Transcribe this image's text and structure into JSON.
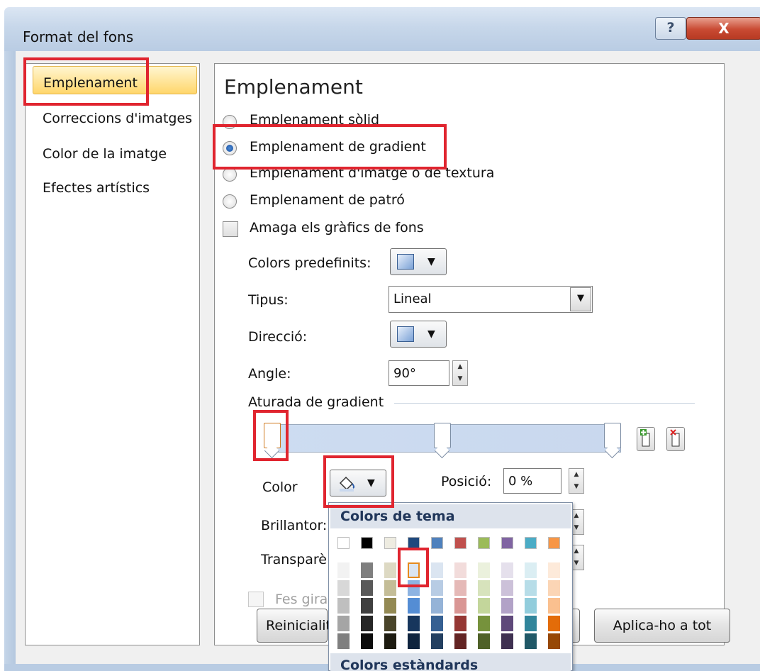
{
  "window": {
    "title": "Format del fons",
    "help_glyph": "?",
    "close_glyph": "X"
  },
  "nav": {
    "items": [
      "Emplenament",
      "Correccions d'imatges",
      "Color de la imatge",
      "Efectes artístics"
    ]
  },
  "panel": {
    "title": "Emplenament",
    "options": [
      "Emplenament sòlid",
      "Emplenament de gradient",
      "Emplenament d'imatge o de textura",
      "Emplenament de patró"
    ],
    "selected_option": "Emplenament de gradient",
    "hide_graphics_label": "Amaga els gràfics de fons",
    "preset_colors_label": "Colors predefinits:",
    "type_label": "Tipus:",
    "type_value": "Lineal",
    "direction_label": "Direcció:",
    "angle_label": "Angle:",
    "angle_value": "90°",
    "gradient_stops_label": "Aturada de gradient",
    "color_label": "Color",
    "position_label": "Posició:",
    "position_value": "0 %",
    "brightness_label": "Brillantor:",
    "transparency_label": "Transparè",
    "rotate_label": "Fes gira",
    "arrow_glyph": "▼",
    "spin_up": "▲",
    "spin_down": "▼"
  },
  "palette": {
    "theme_title": "Colors de tema",
    "standard_title": "Colors estàndards",
    "theme_top_row": [
      "#ffffff",
      "#000000",
      "#eeece1",
      "#1f497d",
      "#4f81bd",
      "#c0504d",
      "#9bbb59",
      "#8064a2",
      "#4bacc6",
      "#f79646"
    ],
    "theme_shades": [
      [
        "#f2f2f2",
        "#7f7f7f",
        "#ddd9c3",
        "#c6d9f0",
        "#dbe5f1",
        "#f2dcdb",
        "#ebf1dd",
        "#e5e0ec",
        "#dbeef3",
        "#fdeada"
      ],
      [
        "#d8d8d8",
        "#595959",
        "#c4bd97",
        "#8db3e2",
        "#b8cce4",
        "#e5b9b7",
        "#d7e3bc",
        "#ccc1d9",
        "#b7dde8",
        "#fbd5b5"
      ],
      [
        "#bfbfbf",
        "#3f3f3f",
        "#938953",
        "#548dd4",
        "#95b3d7",
        "#d99694",
        "#c3d69b",
        "#b2a2c7",
        "#92cddc",
        "#fac08f"
      ],
      [
        "#a5a5a5",
        "#262626",
        "#494429",
        "#17365d",
        "#366092",
        "#953734",
        "#76923c",
        "#5f497a",
        "#31859b",
        "#e36c09"
      ],
      [
        "#7f7f7f",
        "#0c0c0c",
        "#1d1b10",
        "#0f243e",
        "#244061",
        "#632423",
        "#4f6128",
        "#3f3151",
        "#205867",
        "#974806"
      ]
    ],
    "selected_color": "#dbe5f1"
  },
  "buttons": {
    "reset": "Reinicialit",
    "apply_all": "Aplica-ho a tot"
  },
  "colors": {
    "highlight": "#e0252f",
    "nav_selected": "#ffd66b"
  }
}
